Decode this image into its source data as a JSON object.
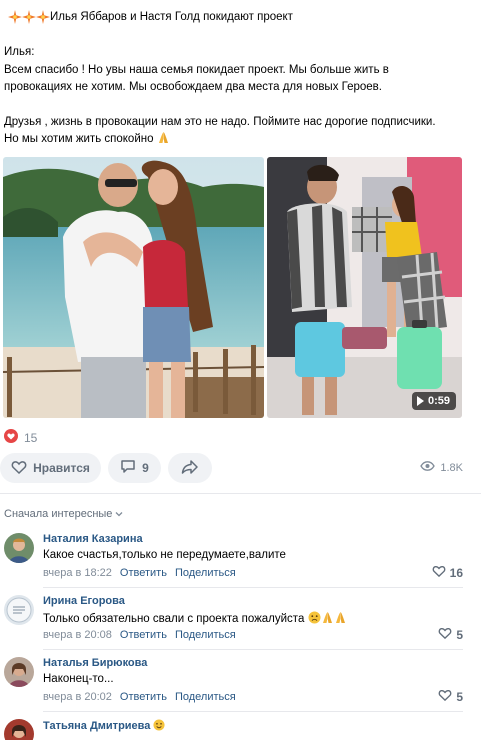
{
  "post": {
    "title": "Илья Яббаров и Настя Голд покидают проект",
    "title_icons": [
      "sparkle-icon",
      "sparkle-icon",
      "sparkle-icon"
    ],
    "lines": [
      "Илья:",
      "Всем спасибо ! Но увы наша семья покидает проект. Мы больше жить в",
      "провокациях не хотим. Мы освобождаем два места для новых Героев.",
      "",
      "Друзья , жизнь в провокации нам это не надо. Поймите нас дорогие подписчики.",
      "Но мы хотим жить спокойно"
    ],
    "end_icon": "praying-hands-icon",
    "video_duration": "0:59"
  },
  "reactions": {
    "icon": "heart-icon",
    "count": "15"
  },
  "actions": {
    "like_label": "Нравится",
    "comments_count": "9",
    "share_icon": "share-arrow-icon",
    "views": "1.8K"
  },
  "comments_sort": "Сначала интересные",
  "comments": [
    {
      "author": "Наталия Казарина",
      "text": "Какое счастья,только не передумаете,валите",
      "time": "вчера в 18:22",
      "reply": "Ответить",
      "share": "Поделиться",
      "likes": "16"
    },
    {
      "author": "Ирина Егорова",
      "text": "Только обязательно свали с проекта пожалуйста",
      "time": "вчера в 20:08",
      "reply": "Ответить",
      "share": "Поделиться",
      "likes": "5"
    },
    {
      "author": "Наталья Бирюкова",
      "text": "Наконец-то...",
      "time": "вчера в 20:02",
      "reply": "Ответить",
      "share": "Поделиться",
      "likes": "5"
    },
    {
      "author": "Татьяна Дмитриева",
      "text": "",
      "time": "",
      "reply": "",
      "share": "",
      "likes": ""
    }
  ],
  "colors": {
    "link": "#2a5885",
    "muted": "#818c99",
    "heart": "#e64646",
    "pill_bg": "#f0f2f5"
  }
}
